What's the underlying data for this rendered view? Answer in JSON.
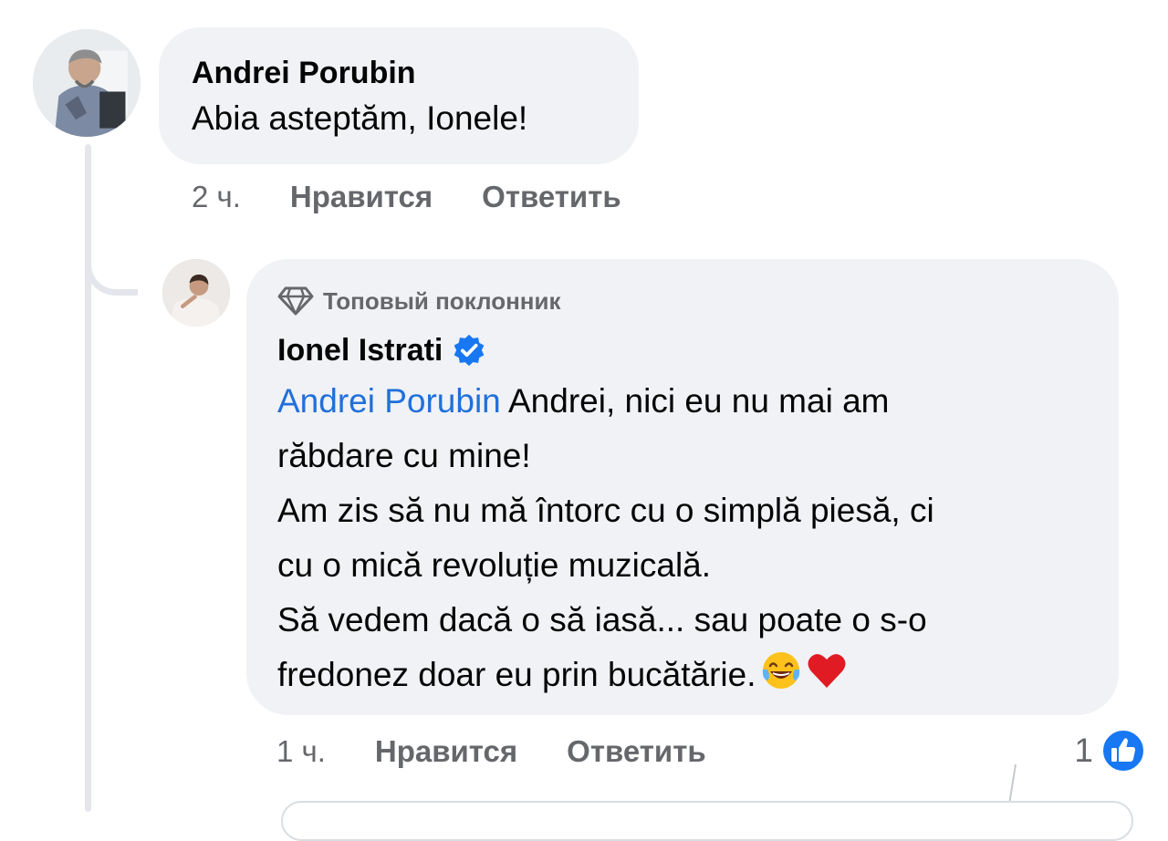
{
  "comment": {
    "author": "Andrei Porubin",
    "text": "Abia asteptăm, Ionele!",
    "time": "2 ч.",
    "like_label": "Нравится",
    "reply_label": "Ответить"
  },
  "reply": {
    "badge": "Топовый поклонник",
    "author": "Ionel Istrati",
    "mention": "Andrei Porubin",
    "lines": [
      " Andrei, nici eu nu mai am",
      "răbdare cu mine!",
      "Am zis să nu mă întorc cu o simplă piesă, ci",
      "cu o mică revoluție muzicală.",
      "Să vedem dacă o să iasă... sau poate o s-o",
      "fredonez doar eu prin bucătărie."
    ],
    "time": "1 ч.",
    "like_label": "Нравится",
    "reply_label": "Ответить",
    "reaction_count": "1"
  },
  "icons": {
    "diamond": "diamond-icon",
    "verified": "verified-badge-icon",
    "laughing": "laughing-emoji",
    "heart": "red-heart-emoji",
    "like": "thumbs-up-icon"
  },
  "colors": {
    "bubble": "#f0f2f5",
    "mention": "#216fdb",
    "secondary_text": "#65676b",
    "like_blue": "#1877f2"
  }
}
